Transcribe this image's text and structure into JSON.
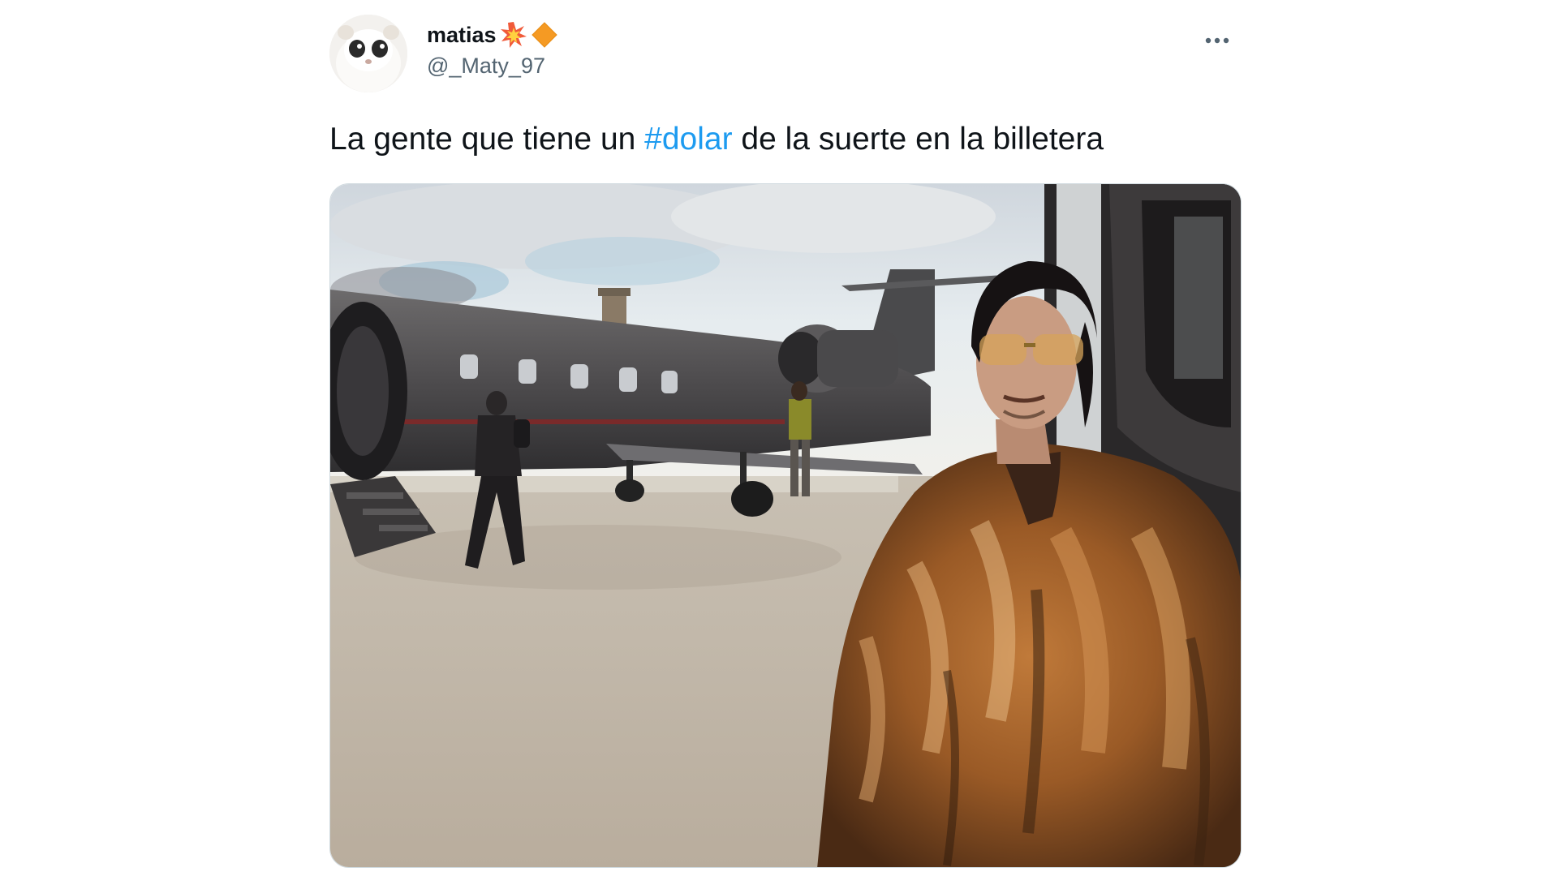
{
  "tweet": {
    "author": {
      "display_name": "matias",
      "handle": "@_Maty_97",
      "name_emojis": [
        "collision-emoji",
        "orange-diamond-emoji"
      ]
    },
    "text_before": "La gente que tiene un ",
    "hashtag": "#dolar",
    "text_after": " de la suerte en la billetera",
    "more_icon": "more-horizontal-icon"
  },
  "colors": {
    "hashtag": "#1d9bf0",
    "handle": "#536471",
    "text": "#0f1419"
  }
}
